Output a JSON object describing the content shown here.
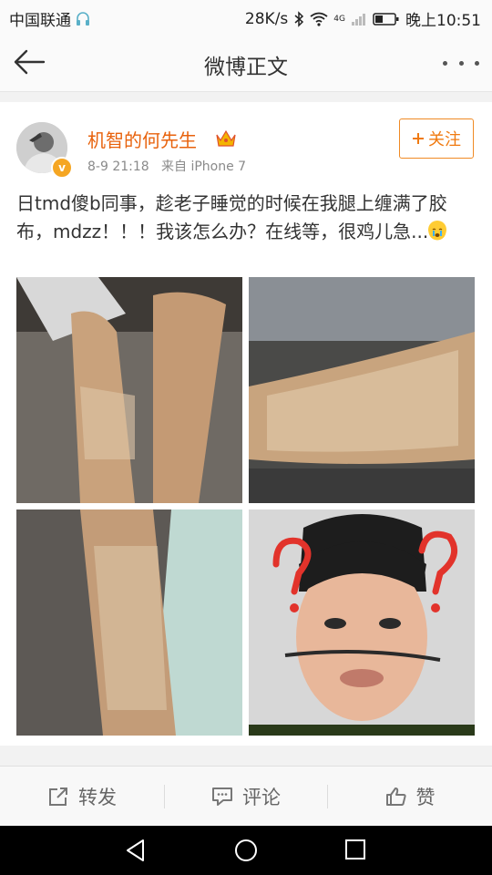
{
  "status": {
    "carrier": "中国联通",
    "speed": "28K/s",
    "time": "晚上10:51",
    "network": "4G"
  },
  "nav": {
    "title": "微博正文"
  },
  "post": {
    "username": "机智的何先生",
    "meta": "8-9 21:18   来自 iPhone 7",
    "follow_label": "关注",
    "text": "日tmd傻b同事，趁老子睡觉的时候在我腿上缠满了胶布，mdzz！！！我该怎么办？在线等，很鸡儿急...",
    "verified_badge": "v",
    "images": [
      {
        "name": "leg-taped-photo-1"
      },
      {
        "name": "leg-taped-photo-2"
      },
      {
        "name": "leg-taped-photo-3"
      },
      {
        "name": "meme-face-photo"
      }
    ]
  },
  "actions": {
    "repost": "转发",
    "comment": "评论",
    "like": "赞"
  },
  "colors": {
    "accent": "#f07a10",
    "username": "#e8620c"
  }
}
